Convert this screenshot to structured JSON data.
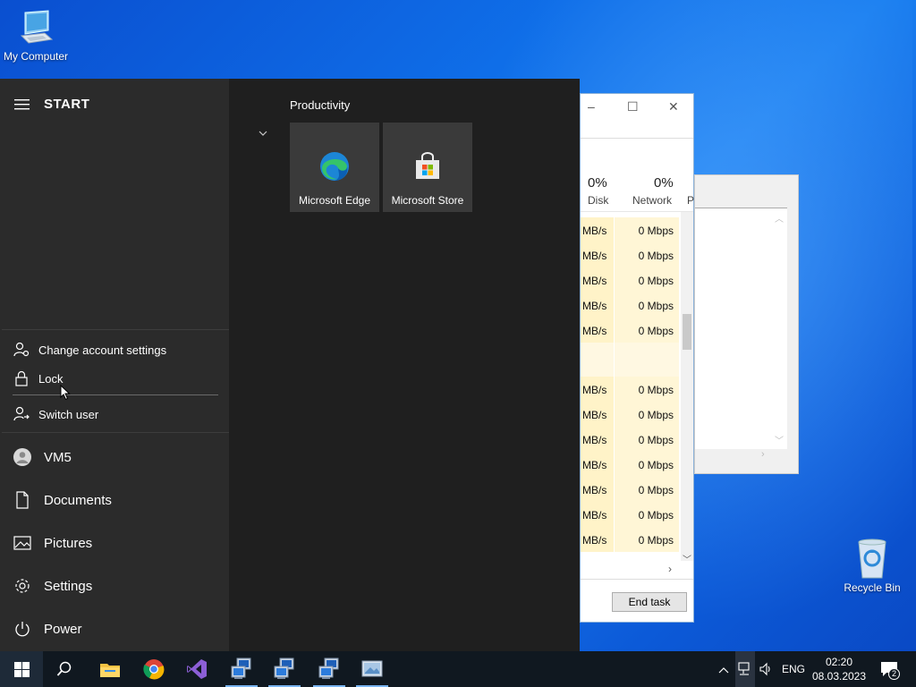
{
  "desktop": {
    "icons": [
      {
        "label": "My Computer"
      },
      {
        "label": "Recycle Bin"
      }
    ]
  },
  "task_manager": {
    "controls": {
      "minimize": "–",
      "maximize": "☐",
      "close": "✕"
    },
    "columns": [
      {
        "pct": "0%",
        "label": "Disk"
      },
      {
        "pct": "0%",
        "label": "Network"
      },
      {
        "pct": "",
        "label": "P"
      }
    ],
    "rows": [
      {
        "disk": "MB/s",
        "network": "0 Mbps"
      },
      {
        "disk": "MB/s",
        "network": "0 Mbps"
      },
      {
        "disk": "MB/s",
        "network": "0 Mbps"
      },
      {
        "disk": "MB/s",
        "network": "0 Mbps"
      },
      {
        "disk": "MB/s",
        "network": "0 Mbps"
      },
      {
        "disk": "",
        "network": ""
      },
      {
        "disk": "MB/s",
        "network": "0 Mbps"
      },
      {
        "disk": "MB/s",
        "network": "0 Mbps"
      },
      {
        "disk": "MB/s",
        "network": "0 Mbps"
      },
      {
        "disk": "MB/s",
        "network": "0 Mbps"
      },
      {
        "disk": "MB/s",
        "network": "0 Mbps"
      },
      {
        "disk": "MB/s",
        "network": "0 Mbps"
      },
      {
        "disk": "MB/s",
        "network": "0 Mbps"
      }
    ],
    "end_task": "End task"
  },
  "start_menu": {
    "title": "START",
    "account_flyout": {
      "items": [
        {
          "label": "Change account settings",
          "icon": "person-settings-icon"
        },
        {
          "label": "Lock",
          "icon": "lock-icon"
        },
        {
          "label": "Switch user",
          "icon": "switch-user-icon"
        }
      ]
    },
    "nav": [
      {
        "label": "VM5",
        "icon": "avatar-icon"
      },
      {
        "label": "Documents",
        "icon": "document-icon"
      },
      {
        "label": "Pictures",
        "icon": "picture-icon"
      },
      {
        "label": "Settings",
        "icon": "gear-icon"
      },
      {
        "label": "Power",
        "icon": "power-icon"
      }
    ],
    "group": {
      "title": "Productivity",
      "tiles": [
        {
          "label": "Microsoft Edge",
          "icon": "edge-icon"
        },
        {
          "label": "Microsoft Store",
          "icon": "store-icon"
        }
      ]
    }
  },
  "taskbar": {
    "apps": [
      {
        "name": "start",
        "icon": "windows-icon"
      },
      {
        "name": "search",
        "icon": "search-icon"
      },
      {
        "name": "file-explorer",
        "icon": "folder-icon"
      },
      {
        "name": "chrome",
        "icon": "chrome-icon"
      },
      {
        "name": "visual-studio",
        "icon": "visual-studio-icon"
      },
      {
        "name": "remote-1",
        "icon": "remote-desktop-icon"
      },
      {
        "name": "remote-2",
        "icon": "remote-desktop-icon"
      },
      {
        "name": "remote-3",
        "icon": "remote-desktop-icon"
      },
      {
        "name": "screenshot-tool",
        "icon": "photo-icon"
      }
    ],
    "tray": {
      "language": "ENG",
      "time": "02:20",
      "date": "08.03.2023",
      "notification_count": "2"
    }
  },
  "colors": {
    "desktop_blue": "#0f6ee8",
    "start_bg": "#1f1f1f",
    "start_left_bg": "#2b2b2b",
    "tile_bg": "#3a3a3a",
    "taskbar_bg": "#101820",
    "row_highlight": "#fff3c8"
  }
}
